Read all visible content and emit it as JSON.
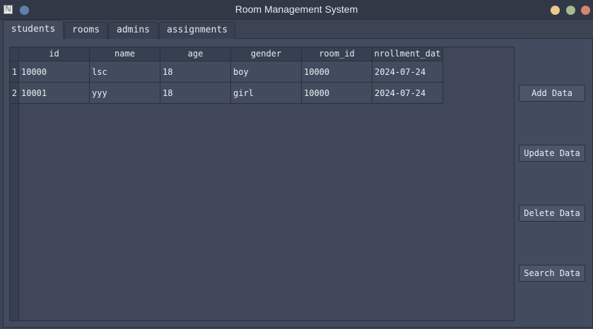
{
  "window": {
    "title": "Room Management System",
    "app_icon_glyph": "ℕ",
    "controls": [
      "minimize-icon",
      "maximize-icon",
      "close-icon"
    ]
  },
  "tabs": [
    {
      "label": "students",
      "active": true
    },
    {
      "label": "rooms",
      "active": false
    },
    {
      "label": "admins",
      "active": false
    },
    {
      "label": "assignments",
      "active": false
    }
  ],
  "table": {
    "columns": [
      "id",
      "name",
      "age",
      "gender",
      "room_id",
      "nrollment_dat"
    ],
    "row_numbers": [
      "1",
      "2"
    ],
    "rows": [
      [
        "10000",
        "lsc",
        "18",
        "boy",
        "10000",
        "2024-07-24"
      ],
      [
        "10001",
        "yyy",
        "18",
        "girl",
        "10000",
        "2024-07-24"
      ]
    ]
  },
  "actions": {
    "add_label": "Add Data",
    "update_label": "Update Data",
    "delete_label": "Delete Data",
    "search_label": "Search Data"
  },
  "colors": {
    "window_bg": "#3c4454",
    "titlebar_bg": "#323846",
    "panel_bg": "#434c5e",
    "button_bg": "#4c566a",
    "text": "#eceff4",
    "dot_blue": "#5e81ac",
    "dot_yellow": "#ebcb8b",
    "dot_green": "#a3be8c",
    "dot_red": "#d08770"
  }
}
